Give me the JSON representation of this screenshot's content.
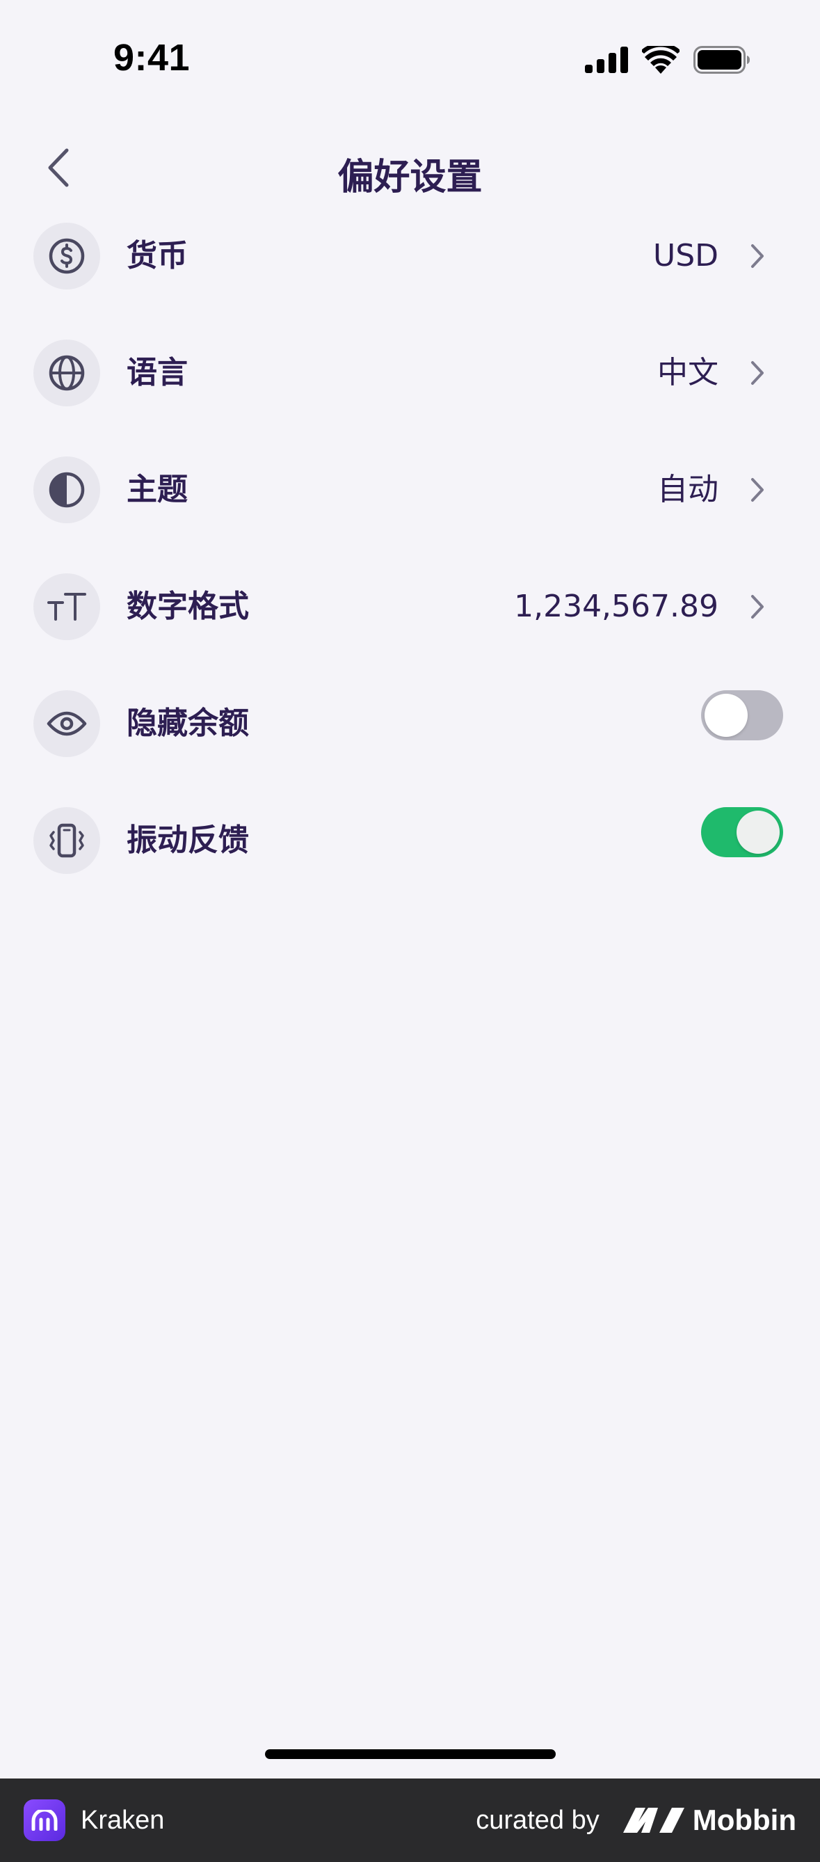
{
  "status_bar": {
    "time": "9:41"
  },
  "header": {
    "title": "偏好设置"
  },
  "settings": [
    {
      "label": "货币",
      "value": "USD",
      "icon": "dollar-circle-icon",
      "type": "link"
    },
    {
      "label": "语言",
      "value": "中文",
      "icon": "globe-icon",
      "type": "link"
    },
    {
      "label": "主题",
      "value": "自动",
      "icon": "half-circle-icon",
      "type": "link"
    },
    {
      "label": "数字格式",
      "value": "1,234,567.89",
      "icon": "text-size-icon",
      "type": "link"
    },
    {
      "label": "隐藏余额",
      "icon": "eye-icon",
      "type": "toggle",
      "enabled": false
    },
    {
      "label": "振动反馈",
      "icon": "phone-vibrate-icon",
      "type": "toggle",
      "enabled": true
    }
  ],
  "footer": {
    "app_name": "Kraken",
    "curated_by": "curated by",
    "brand": "Mobbin"
  },
  "colors": {
    "background": "#f5f4f9",
    "text_primary": "#2d1e52",
    "toggle_on": "#1fba6c",
    "toggle_off": "#b9b8c2"
  }
}
